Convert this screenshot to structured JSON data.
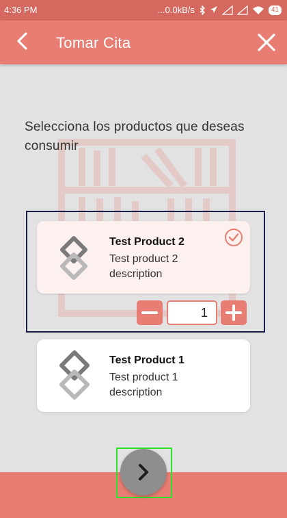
{
  "status_bar": {
    "time": "4:36 PM",
    "network_speed": "...0.0kB/s",
    "battery": "41"
  },
  "header": {
    "title": "Tomar Cita",
    "back_icon": "chevron-left-icon",
    "close_icon": "close-icon"
  },
  "prompt": "Selecciona los productos que deseas consumir",
  "products": [
    {
      "name": "Test Product 2",
      "description": "Test product 2 description",
      "selected": true,
      "quantity": "1"
    },
    {
      "name": "Test Product 1",
      "description": "Test product 1 description",
      "selected": false
    }
  ],
  "colors": {
    "accent": "#e87e73",
    "status_bar": "#d6695f",
    "background": "#e2e2e2",
    "selection_frame": "#1a1f4a",
    "next_frame": "#2ee22e",
    "next_button": "#8e8e8e"
  },
  "next_button_icon": "chevron-right-icon"
}
